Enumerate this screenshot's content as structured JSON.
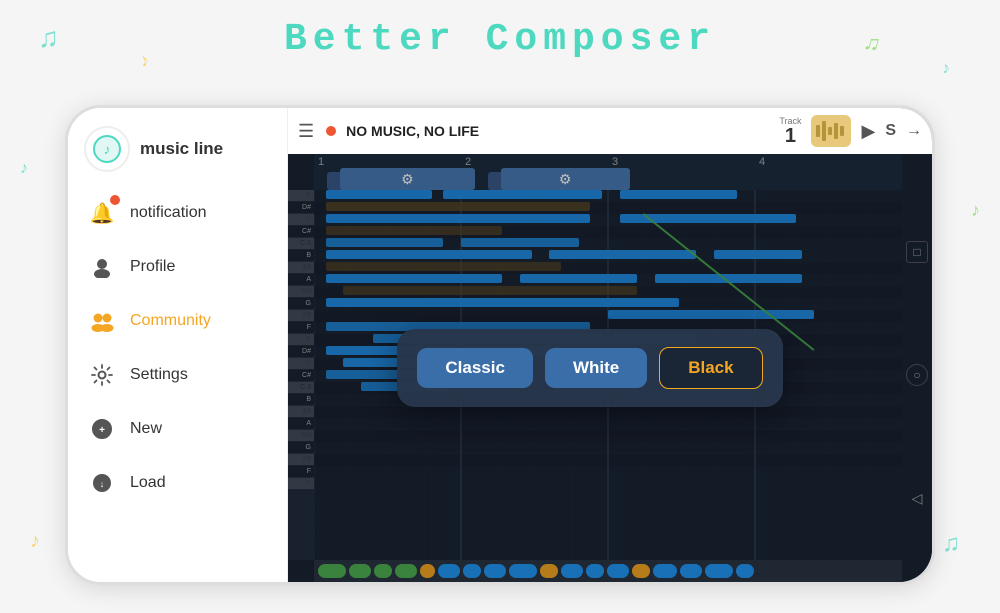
{
  "app": {
    "title": "Better Composer"
  },
  "sidebar": {
    "logo_text": "music line",
    "items": [
      {
        "id": "notification",
        "label": "notification",
        "icon": "bell"
      },
      {
        "id": "profile",
        "label": "Profile",
        "icon": "person"
      },
      {
        "id": "community",
        "label": "Community",
        "icon": "people",
        "active": true
      },
      {
        "id": "settings",
        "label": "Settings",
        "icon": "gear"
      },
      {
        "id": "new",
        "label": "New",
        "icon": "new"
      },
      {
        "id": "load",
        "label": "Load",
        "icon": "load"
      }
    ]
  },
  "topbar": {
    "song_title": "NO MUSIC, NO LIFE",
    "track_label": "Track",
    "track_num": "1"
  },
  "popup": {
    "classic_label": "Classic",
    "white_label": "White",
    "black_label": "Black"
  },
  "colors": {
    "accent_teal": "#4dd9c0",
    "accent_orange": "#f5a623",
    "active_blue": "#2196f3",
    "bg_dark": "#1a2535",
    "sidebar_bg": "#ffffff"
  }
}
